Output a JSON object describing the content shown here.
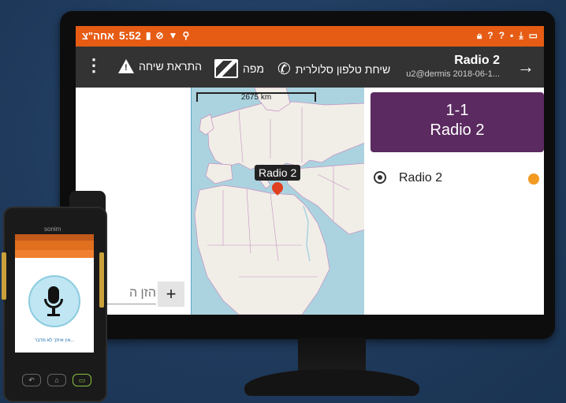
{
  "status_bar": {
    "time": "5:52",
    "time_suffix": "אחה\"צ",
    "left_icons": [
      "battery-low-icon",
      "no-sim-icon",
      "wifi-icon",
      "location-icon"
    ],
    "right_icons": [
      "lock-icon",
      "unknown-network-icon",
      "unknown-network-icon",
      "sd-card-icon",
      "download-icon",
      "image-icon"
    ],
    "color": "#e65c14"
  },
  "toolbar": {
    "more_label": "⋮",
    "alarm_label": "התראת שיחה",
    "map_label": "מפה",
    "phone_label": "שיחת טלפון סלולרית",
    "title": "Radio 2",
    "subtitle": "u2@dermis 2018-06-1...",
    "back_label": "→",
    "color": "#333333"
  },
  "chat": {
    "input_placeholder": "הזן ה",
    "add_label": "+"
  },
  "map": {
    "scale_label": "2675 km",
    "marker_label": "Radio 2"
  },
  "call_card": {
    "line1": "1-1",
    "line2": "Radio 2",
    "color": "#5b2a60"
  },
  "members": [
    {
      "name": "Radio 2",
      "status_color": "#f29a22"
    }
  ],
  "phone": {
    "brand": "sonim",
    "ptt_hint": "אין איתך לא מדבר..."
  }
}
